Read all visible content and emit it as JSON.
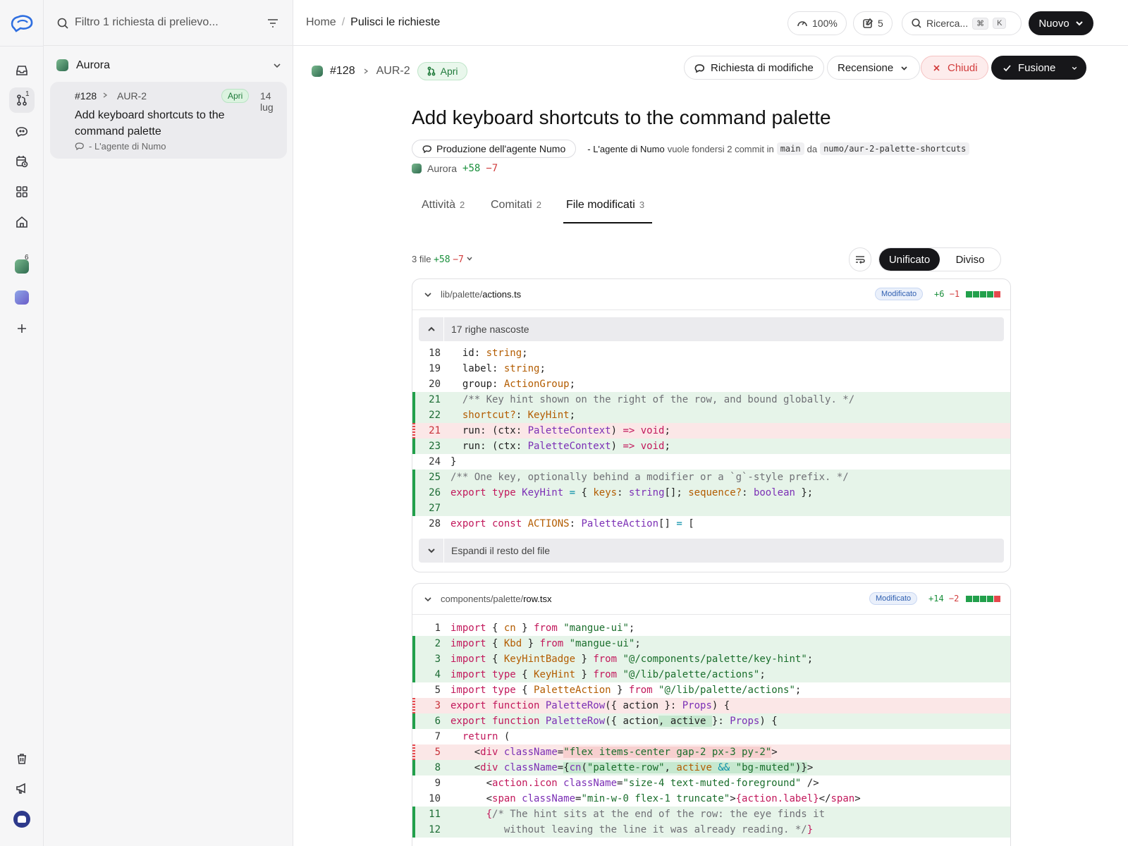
{
  "sidebar": {
    "search_placeholder": "Filtro 1 richiesta di prelievo...",
    "badge_pr": "1",
    "badge_ws": "6",
    "repo_name": "Aurora",
    "card": {
      "number": "#128",
      "key": "AUR-2",
      "status": "Apri",
      "date": "14 lug",
      "title": "Add keyboard shortcuts to the command palette",
      "agent": "- L'agente di Numo"
    }
  },
  "topbar": {
    "crumb_home": "Home",
    "crumb_sep": "/",
    "crumb_current": "Pulisci le richieste",
    "zoom": "100%",
    "notes_count": "5",
    "search_label": "Ricerca...",
    "search_kbd1": "⌘",
    "search_kbd2": "K",
    "new_label": "Nuovo"
  },
  "pr": {
    "number": "#128",
    "key": "AUR-2",
    "status": "Apri",
    "actions": {
      "request_changes": "Richiesta di modifiche",
      "review": "Recensione",
      "close": "Chiudi",
      "merge": "Fusione"
    },
    "title": "Add keyboard shortcuts to the command palette",
    "agent_pill": "Produzione dell'agente Numo",
    "meta_author": "- L'agente di Numo",
    "meta_text": "vuole fondersi 2 commit in",
    "base_branch": "main",
    "meta_from": "da",
    "head_branch": "numo/aur-2-palette-shortcuts",
    "repo": "Aurora",
    "additions": "+58",
    "deletions": "−7"
  },
  "tabs": [
    {
      "label": "Attività",
      "count": "2"
    },
    {
      "label": "Comitati",
      "count": "2"
    },
    {
      "label": "File modificati",
      "count": "3"
    }
  ],
  "files_bar": {
    "summary": "3 file",
    "additions": "+58",
    "deletions": "−7",
    "unified": "Unificato",
    "split": "Diviso"
  },
  "file1": {
    "dir": "lib/palette/",
    "name": "actions.ts",
    "status": "Modificato",
    "additions": "+6",
    "deletions": "−1",
    "hidden": "17 righe nascoste",
    "expand": "Espandi il resto del file"
  },
  "file2": {
    "dir": "components/palette/",
    "name": "row.tsx",
    "status": "Modificato",
    "additions": "+14",
    "deletions": "−2"
  },
  "colors": {
    "accent_dark": "#17171a",
    "add_green": "#22a04b",
    "del_red": "#e5484d",
    "open_green": "#1f7a3a",
    "modified_blue": "#2f5fb0"
  }
}
